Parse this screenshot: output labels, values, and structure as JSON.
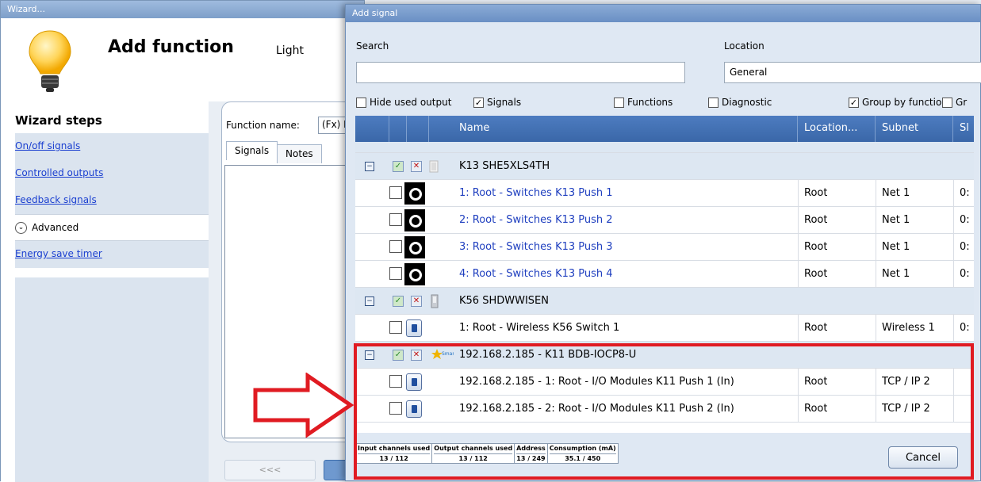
{
  "wizard": {
    "window_title": "Wizard...",
    "heading": "Add function",
    "subheading": "Light",
    "steps_title": "Wizard steps",
    "steps": [
      "On/off signals",
      "Controlled outputs",
      "Feedback signals"
    ],
    "advanced_label": "Advanced",
    "energy_link": "Energy save timer",
    "function_name_label": "Function name:",
    "function_name_value": "(Fx) Ro",
    "tabs": [
      "Signals",
      "Notes"
    ],
    "prev_button": "<<<"
  },
  "dialog": {
    "title": "Add signal",
    "search_label": "Search",
    "location_label": "Location",
    "location_value": "General",
    "filters": [
      {
        "label": "Hide used output",
        "checked": false
      },
      {
        "label": "Signals",
        "checked": true
      },
      {
        "label": "Functions",
        "checked": false
      },
      {
        "label": "Diagnostic",
        "checked": false
      },
      {
        "label": "Group by function",
        "checked": true
      },
      {
        "label": "Gr",
        "checked": false
      }
    ],
    "columns": [
      "Name",
      "Location...",
      "Subnet",
      "Sl"
    ],
    "groups": [
      {
        "name": "K13 SHE5XLS4TH",
        "rows": [
          {
            "name": "1: Root - Switches K13 Push 1",
            "location": "Root",
            "subnet": "Net 1",
            "sl": "0:"
          },
          {
            "name": "2: Root - Switches K13 Push 2",
            "location": "Root",
            "subnet": "Net 1",
            "sl": "0:"
          },
          {
            "name": "3: Root - Switches K13 Push 3",
            "location": "Root",
            "subnet": "Net 1",
            "sl": "0:"
          },
          {
            "name": "4: Root - Switches K13 Push 4",
            "location": "Root",
            "subnet": "Net 1",
            "sl": "0:"
          }
        ]
      },
      {
        "name": "K56 SHDWWISEN",
        "rows": [
          {
            "name": "1: Root - Wireless K56 Switch 1",
            "location": "Root",
            "subnet": "Wireless 1",
            "sl": "0:"
          }
        ]
      },
      {
        "name": "192.168.2.185 - K11 BDB-IOCP8-U",
        "rows": [
          {
            "name": "192.168.2.185 - 1: Root - I/O Modules K11 Push 1 (In)",
            "location": "Root",
            "subnet": "TCP / IP 2",
            "sl": ""
          },
          {
            "name": "192.168.2.185 - 2: Root - I/O Modules K11 Push 2 (In)",
            "location": "Root",
            "subnet": "TCP / IP 2",
            "sl": ""
          }
        ]
      }
    ],
    "stats": [
      {
        "label": "Input channels used",
        "value": "13 / 112"
      },
      {
        "label": "Output channels used",
        "value": "13 / 112"
      },
      {
        "label": "Address",
        "value": "13 / 249"
      },
      {
        "label": "Consumption (mA)",
        "value": "35.1 / 450"
      }
    ],
    "cancel_button": "Cancel"
  }
}
